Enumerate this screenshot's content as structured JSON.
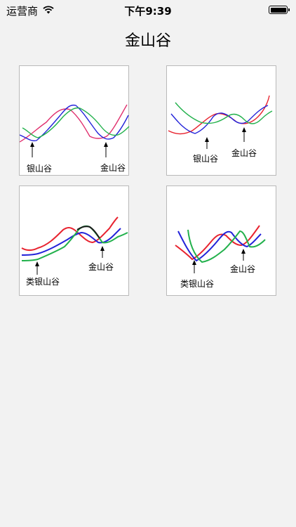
{
  "status_bar": {
    "carrier": "运营商",
    "time": "下午9:39"
  },
  "title": "金山谷",
  "cards": [
    {
      "labels": [
        "银山谷",
        "金山谷"
      ]
    },
    {
      "labels": [
        "银山谷",
        "金山谷"
      ]
    },
    {
      "labels": [
        "类银山谷",
        "金山谷"
      ]
    },
    {
      "labels": [
        "类银山谷",
        "金山谷"
      ]
    }
  ],
  "colors": {
    "red": "#e8232f",
    "blue": "#2323d9",
    "green": "#22b14c",
    "pink": "#e0306e",
    "card_border": "#b9b9b9"
  }
}
